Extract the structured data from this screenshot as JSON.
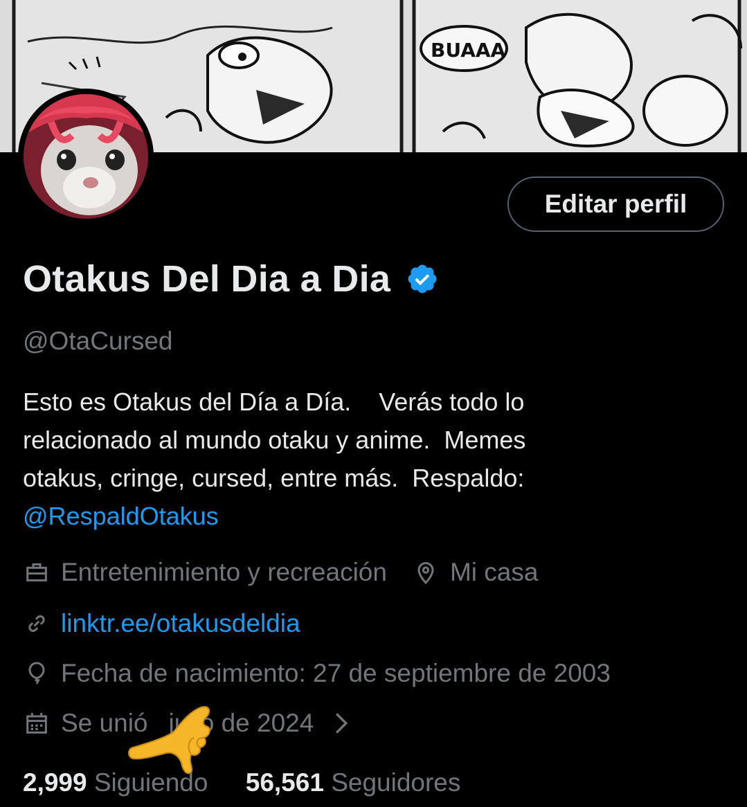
{
  "banner": {
    "speech_text": "BUAAA"
  },
  "profile": {
    "edit_button": "Editar perfil",
    "display_name": "Otakus Del Dia a Dia",
    "verified_icon": "verified-badge-icon",
    "handle": "@OtaCursed",
    "bio_lines": [
      "Esto es Otakus del Día a Día.    Verás todo lo",
      "relacionado al mundo otaku y anime.  Memes",
      "otakus, cringe, cursed, entre más.  Respaldo:"
    ],
    "bio_mention": "@RespaldOtakus",
    "category": "Entretenimiento y recreación",
    "location": "Mi casa",
    "website": "linktr.ee/otakusdeldia",
    "birthday": "Fecha de nacimiento: 27 de septiembre de 2003",
    "joined_prefix": "Se unió",
    "joined_suffix": "julio de 2024",
    "following_count": "2,999",
    "following_label": "Siguiendo",
    "followers_count": "56,561",
    "followers_label": "Seguidores"
  },
  "colors": {
    "background": "#000000",
    "primary_text": "#e7e9ea",
    "secondary_text": "#71767b",
    "link": "#1d9bf0",
    "verified": "#1d9bf0"
  }
}
